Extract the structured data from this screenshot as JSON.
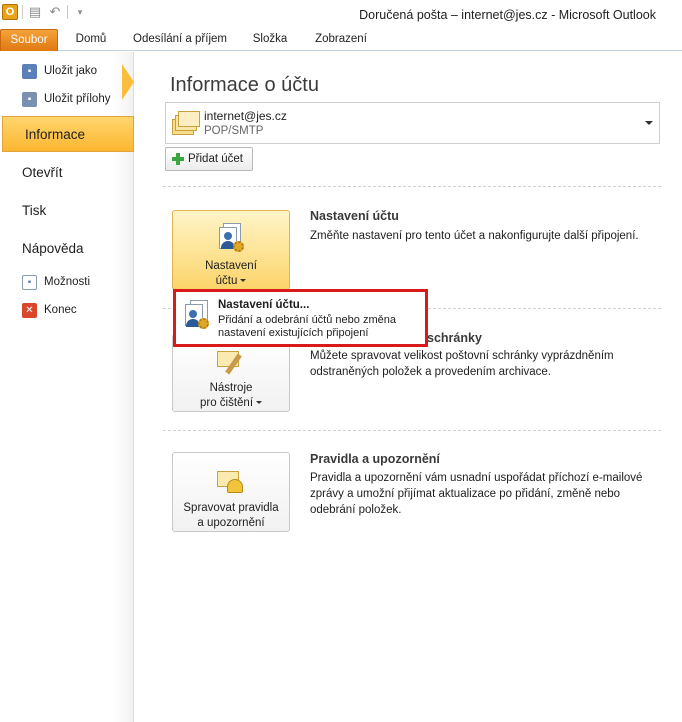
{
  "window": {
    "title": "Doručená pošta – internet@jes.cz  -  Microsoft Outlook",
    "app_icon_letter": "O"
  },
  "ribbon": {
    "tabs": [
      "Soubor",
      "Domů",
      "Odesílání a příjem",
      "Složka",
      "Zobrazení"
    ],
    "active_tab": "Soubor"
  },
  "backstage": {
    "commands_top": [
      "Uložit jako",
      "Uložit přílohy"
    ],
    "items": [
      "Informace",
      "Otevřít",
      "Tisk",
      "Nápověda"
    ],
    "active_item": "Informace",
    "commands_bottom": [
      "Možnosti",
      "Konec"
    ]
  },
  "main": {
    "title": "Informace o účtu",
    "account": {
      "email": "internet@jes.cz",
      "type": "POP/SMTP"
    },
    "add_account_label": "Přidat účet",
    "sections": [
      {
        "button_label_1": "Nastavení",
        "button_label_2": "účtu",
        "title": "Nastavení účtu",
        "description": "Změňte nastavení pro tento účet a nakonfigurujte další připojení."
      },
      {
        "button_label_1": "Nástroje",
        "button_label_2": "pro čištění",
        "title": "schránky",
        "description": "Můžete spravovat velikost poštovní schránky vyprázdněním odstraněných položek a provedením archivace."
      },
      {
        "button_label_1": "Spravovat pravidla",
        "button_label_2": "a upozornění",
        "title": "Pravidla a upozornění",
        "description": "Pravidla a upozornění vám usnadní uspořádat příchozí e-mailové zprávy a umožní přijímat aktualizace po přidání, změně nebo odebrání položek."
      }
    ]
  },
  "menu": {
    "title": "Nastavení účtu...",
    "description": "Přidání a odebrání účtů nebo změna nastavení existujících připojení"
  },
  "colors": {
    "file_tab": "#e07810",
    "active_nav": "#fbb630",
    "highlight_border": "#d81a1a"
  }
}
